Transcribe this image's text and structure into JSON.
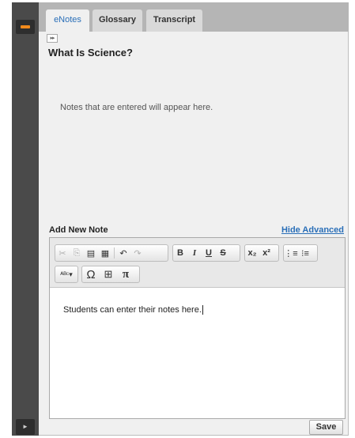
{
  "tabs": [
    {
      "label": "eNotes"
    },
    {
      "label": "Glossary"
    },
    {
      "label": "Transcript"
    }
  ],
  "page_title": "What Is Science?",
  "notes_empty_message": "Notes that are entered will appear here.",
  "add_note_label": "Add New Note",
  "hide_advanced_label": "Hide Advanced",
  "editor": {
    "content": "Students can enter their notes here.",
    "toolbar_icons": [
      "cut-icon",
      "copy-icon",
      "paste-icon",
      "paste-word-icon",
      "undo-icon",
      "redo-icon",
      "bold-icon",
      "italic-icon",
      "underline-icon",
      "strikethrough-icon",
      "subscript-icon",
      "superscript-icon",
      "numbered-list-icon",
      "bulleted-list-icon",
      "spellcheck-icon",
      "special-character-icon",
      "table-icon",
      "math-pi-icon"
    ],
    "bold_glyph": "B",
    "italic_glyph": "I",
    "underline_glyph": "U",
    "strike_glyph": "S",
    "omega_glyph": "Ω",
    "pi_glyph": "π"
  },
  "save_label": "Save",
  "colors": {
    "accent_orange": "#f28a1c",
    "link_blue": "#2a6fb8",
    "rail_dark": "#4a4a4a"
  }
}
